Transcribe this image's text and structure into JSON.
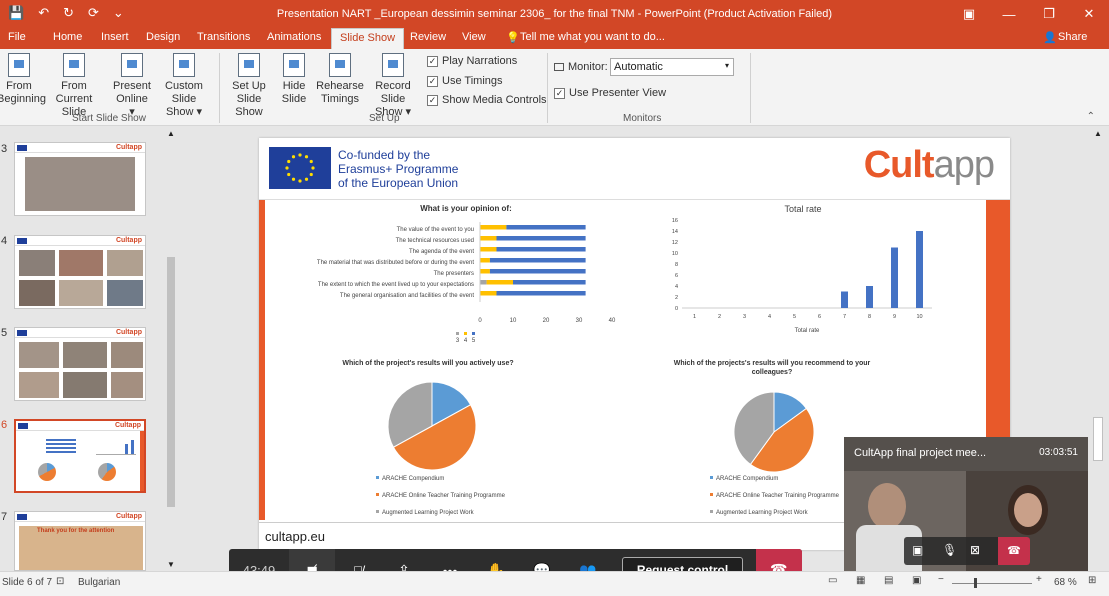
{
  "titlebar": {
    "title": "Presentation NART _European dessimin seminar 2306_ for the final TNM - PowerPoint (Product Activation Failed)",
    "qat": [
      "💾",
      "↶",
      "↻",
      "⟳",
      "⌄"
    ],
    "win": [
      "▣",
      "—",
      "❐",
      "✕"
    ]
  },
  "tabs": [
    {
      "label": "File",
      "active": false
    },
    {
      "label": "Home",
      "active": false
    },
    {
      "label": "Insert",
      "active": false
    },
    {
      "label": "Design",
      "active": false
    },
    {
      "label": "Transitions",
      "active": false
    },
    {
      "label": "Animations",
      "active": false
    },
    {
      "label": "Slide Show",
      "active": true
    },
    {
      "label": "Review",
      "active": false
    },
    {
      "label": "View",
      "active": false
    }
  ],
  "tellme": "Tell me what you want to do...",
  "share": "Share",
  "ribbon": {
    "buttons": [
      {
        "label1": "From",
        "label2": "Beginning"
      },
      {
        "label1": "From",
        "label2": "Current Slide"
      },
      {
        "label1": "Present",
        "label2": "Online ▾"
      },
      {
        "label1": "Custom Slide",
        "label2": "Show ▾"
      },
      {
        "label1": "Set Up",
        "label2": "Slide Show"
      },
      {
        "label1": "Hide",
        "label2": "Slide"
      },
      {
        "label1": "Rehearse",
        "label2": "Timings"
      },
      {
        "label1": "Record Slide",
        "label2": "Show ▾"
      }
    ],
    "groups": [
      "Start Slide Show",
      "Set Up",
      "Monitors"
    ],
    "checks": [
      {
        "label": "Play Narrations",
        "checked": true
      },
      {
        "label": "Use Timings",
        "checked": true
      },
      {
        "label": "Show Media Controls",
        "checked": true
      }
    ],
    "monitor_label": "Monitor:",
    "monitor_value": "Automatic",
    "presenter": {
      "label": "Use Presenter View",
      "checked": true
    }
  },
  "thumbs": [
    {
      "num": "3"
    },
    {
      "num": "4"
    },
    {
      "num": "5"
    },
    {
      "num": "6"
    },
    {
      "num": "7"
    }
  ],
  "thumb7_text": "Thank you for the attention",
  "slide": {
    "eu_lines": [
      "Co-funded by the",
      "Erasmus+ Programme",
      "of the European Union"
    ],
    "logo_main": "Cult",
    "logo_sub": "app",
    "footer": "cultapp.eu"
  },
  "chart_data": [
    {
      "type": "bar",
      "orientation": "horizontal",
      "stacked": true,
      "title": "What is your opinion of:",
      "categories": [
        "The value of the event to you",
        "The technical resources used",
        "The agenda of the event",
        "The material that was distributed before or during the event",
        "The presenters",
        "The extent to which the event lived up to your expectations",
        "The general organisation and facilities of the event"
      ],
      "series": [
        {
          "name": "3",
          "color": "#a5a5a5",
          "values": [
            0,
            0,
            0,
            0,
            0,
            2,
            0
          ]
        },
        {
          "name": "4",
          "color": "#ffc000",
          "values": [
            8,
            5,
            5,
            3,
            3,
            8,
            5
          ]
        },
        {
          "name": "5",
          "color": "#4472c4",
          "values": [
            24,
            27,
            27,
            29,
            29,
            22,
            27
          ]
        }
      ],
      "xticks": [
        "0",
        "10",
        "20",
        "30",
        "40"
      ],
      "xlim": [
        0,
        40
      ]
    },
    {
      "type": "bar",
      "title": "Total rate",
      "xlabel": "Total rate",
      "categories": [
        "1",
        "2",
        "3",
        "4",
        "5",
        "6",
        "7",
        "8",
        "9",
        "10"
      ],
      "values": [
        0,
        0,
        0,
        0,
        0,
        0,
        3,
        4,
        11,
        14
      ],
      "yticks": [
        "0",
        "2",
        "4",
        "6",
        "8",
        "10",
        "12",
        "14",
        "16"
      ],
      "ylim": [
        0,
        16
      ],
      "color": "#4472c4"
    },
    {
      "type": "pie",
      "title": "Which of the project's results will you actively use?",
      "labels": [
        "ARACHE Compendium",
        "ARACHE Online Teacher Training Programme",
        "Augmented Learning Project Work"
      ],
      "values": [
        17,
        50,
        33
      ],
      "colors": [
        "#5b9bd5",
        "#ed7d31",
        "#a5a5a5"
      ]
    },
    {
      "type": "pie",
      "title": "Which of the projects's results will you recommend to your colleagues?",
      "labels": [
        "ARACHE Compendium",
        "ARACHE Online Teacher Training Programme",
        "Augmented Learning Project Work"
      ],
      "values": [
        15,
        45,
        40
      ],
      "colors": [
        "#5b9bd5",
        "#ed7d31",
        "#a5a5a5"
      ]
    }
  ],
  "call": {
    "time": "43:49",
    "request": "Request control"
  },
  "video": {
    "title": "CultApp final project mee...",
    "time": "03:03:51"
  },
  "status": {
    "slide": "Slide 6 of 7",
    "lang": "Bulgarian",
    "zoom": "68 %"
  }
}
